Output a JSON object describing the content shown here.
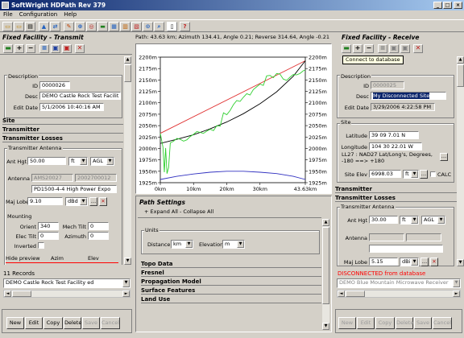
{
  "window": {
    "title": "SoftWright HDPath Rev 379"
  },
  "menu": [
    "File",
    "Configuration",
    "Help"
  ],
  "path_info": "Path: 43.63 km; Azimuth 134.41, Angle 0.21; Reverse 314.64, Angle -0.21",
  "left": {
    "header": "Fixed Facility - Transmit",
    "description": {
      "title": "Description",
      "id_label": "ID",
      "id": "0000026",
      "desc_label": "Desc",
      "desc": "DEMO Castle Rock Test Facilit",
      "edit_date_label": "Edit Date",
      "edit_date": "5/1/2006 10:40:16 AM"
    },
    "sections": [
      "Site",
      "Transmitter",
      "Transmitter Losses"
    ],
    "antenna": {
      "title": "Transmitter Antenna",
      "ant_hgt_label": "Ant Hgt",
      "ant_hgt": "50.00",
      "unit_ft": "ft",
      "agl": "AGL",
      "antenna_label": "Antenna",
      "antenna_code1": "AMS20027",
      "antenna_code2": "2002700012",
      "antenna_model": "PD1500-4-4 High Power Expo",
      "maj_lobe_label": "Maj Lobe",
      "maj_lobe": "9.10",
      "unit_dbd": "dBd",
      "mounting_label": "Mounting",
      "orient_label": "Orient",
      "orient": "340",
      "mech_tilt_label": "Mech Tilt",
      "mech_tilt": "0",
      "elec_tilt_label": "Elec Tilt",
      "elec_tilt": "0",
      "azimuth_label": "Azimuth",
      "azimuth": "0",
      "inverted_label": "Inverted",
      "hide_preview_label": "Hide preview",
      "azim_label": "Azim",
      "elev_label": "Elev"
    },
    "records": "11 Records",
    "facility_select": "DEMO Castle Rock Test Facility ed",
    "buttons": [
      "New",
      "Edit",
      "Copy",
      "Delete",
      "Save",
      "Cancel"
    ]
  },
  "right": {
    "header": "Fixed Facility - Receive",
    "tooltip": "Connect to database",
    "description": {
      "title": "Description",
      "id_label": "ID",
      "id": "0000025",
      "desc_label": "Desc",
      "desc": "My Disconnected Site",
      "edit_date_label": "Edit Date",
      "edit_date": "3/29/2006 4:22:58 PM"
    },
    "site": {
      "title": "Site",
      "latitude_label": "Latitude",
      "latitude": "39 09 7.01 N",
      "longitude_label": "Longitude",
      "longitude": "104 30 22.01 W",
      "datum_text": "LL27 : NAD27 Lat/Long's, Degrees, -180 ==> +180",
      "site_elev_label": "Site Elev",
      "site_elev": "6998.03",
      "unit_ft": "ft",
      "calc_label": "CALC"
    },
    "sections": [
      "Transmitter",
      "Transmitter Losses"
    ],
    "antenna": {
      "title": "Transmitter Antenna",
      "ant_hgt_label": "Ant Hgt",
      "ant_hgt": "30.00",
      "unit_ft": "ft",
      "agl": "AGL",
      "antenna_label": "Antenna",
      "maj_lobe_label": "Maj Lobe",
      "maj_lobe": "5.15",
      "unit_dbi": "dBi"
    },
    "status": "DISCONNECTED from database",
    "facility_select": "DEMO Blue Mountain Microwave Receiver",
    "buttons": [
      "New",
      "Edit",
      "Copy",
      "Delete",
      "Save",
      "Cancel"
    ]
  },
  "center": {
    "path_settings": {
      "title": "Path Settings",
      "expand_all": "+ Expand All",
      "collapse_all": "- Collapse All",
      "units_label": "Units",
      "distance_label": "Distance",
      "distance_unit": "km",
      "elevation_label": "Elevation",
      "elevation_unit": "m",
      "sections": [
        "Topo Data",
        "Fresnel",
        "Propagation Model",
        "Surface Features",
        "Land Use"
      ]
    }
  },
  "colors": {
    "los": "#e03030",
    "terrain": "#30d030",
    "fresnel": "#3030c0",
    "earth": "#000000",
    "status": "#ff0000",
    "selection": "#0a246a"
  },
  "chart_data": {
    "type": "line",
    "title": "",
    "xlabel": "",
    "ylabel": "",
    "xlim": [
      0,
      43.63
    ],
    "ylim": [
      1925,
      2200
    ],
    "x_ticks": [
      "0km",
      "10km",
      "20km",
      "30km",
      "43.63km"
    ],
    "y_ticks": [
      "2200m",
      "2175m",
      "2150m",
      "2125m",
      "2100m",
      "2075m",
      "2050m",
      "2025m",
      "2000m",
      "1975m",
      "1950m",
      "1925m"
    ],
    "series": [
      {
        "color": "#e03030",
        "x": [
          0,
          43.63
        ],
        "y": [
          2033,
          2192
        ]
      },
      {
        "color": "#000000",
        "x": [
          0,
          5,
          10,
          15,
          20,
          25,
          30,
          35,
          40,
          43.63
        ],
        "y": [
          2011,
          2020,
          2030,
          2043,
          2058,
          2076,
          2098,
          2124,
          2158,
          2192
        ]
      },
      {
        "color": "#3030c0",
        "x": [
          0,
          5,
          10,
          15,
          20,
          25,
          30,
          35,
          40,
          43.63
        ],
        "y": [
          1932,
          1939,
          1944,
          1948,
          1950,
          1950,
          1948,
          1945,
          1939,
          1932
        ]
      },
      {
        "color": "#30d030",
        "x": [
          0,
          0.8,
          1.2,
          1.6,
          2,
          2.5,
          3,
          4,
          5,
          6,
          7,
          8,
          9,
          10,
          11,
          12,
          13,
          14,
          15,
          16,
          17,
          18,
          19,
          20,
          21,
          22,
          23,
          24,
          25,
          26,
          27,
          28,
          29,
          30,
          31,
          32,
          33,
          34,
          35,
          36,
          37,
          38,
          39,
          40,
          41,
          42,
          43,
          43.63
        ],
        "y": [
          2033,
          2003,
          1948,
          2001,
          1945,
          1958,
          2012,
          2016,
          2022,
          2020,
          2016,
          2019,
          2026,
          2031,
          2037,
          2035,
          2033,
          2038,
          2042,
          2039,
          2050,
          2049,
          2078,
          2074,
          2083,
          2096,
          2105,
          2103,
          2112,
          2120,
          2117,
          2129,
          2135,
          2141,
          2138,
          2159,
          2160,
          2155,
          2164,
          2163,
          2152,
          2149,
          2156,
          2162,
          2161,
          2164,
          2170,
          2172
        ]
      }
    ]
  }
}
